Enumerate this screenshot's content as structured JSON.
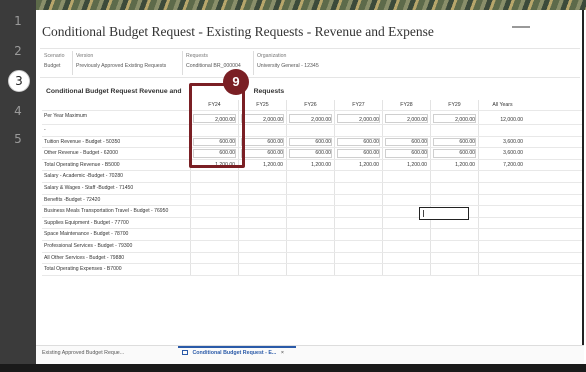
{
  "steps": [
    "1",
    "2",
    "3",
    "4",
    "5"
  ],
  "active_step": "3",
  "page_title": "Conditional Budget Request - Existing Requests - Revenue and Expense",
  "pov": [
    {
      "label": "Scenario",
      "value": "Budget"
    },
    {
      "label": "Version",
      "value": "Previously Approved Existing Requests"
    },
    {
      "label": "Requests",
      "value": "Conditional BR_000004"
    },
    {
      "label": "Organization",
      "value": "University General - 12345"
    }
  ],
  "grid_title": "Conditional Budget Request Revenue and Expense by Requests",
  "grid_title_visible": "Conditional Budget Request Revenue and",
  "grid_title_tail": "Requests",
  "columns": [
    "FY24",
    "FY25",
    "FY26",
    "FY27",
    "FY28",
    "FY29",
    "All Years"
  ],
  "rows": [
    {
      "label": "Per Year Maximum",
      "values": [
        "2,000.00",
        "2,000.00",
        "2,000.00",
        "2,000.00",
        "2,000.00",
        "2,000.00",
        "12,000.00"
      ]
    },
    {
      "label": "-",
      "values": [
        "",
        "",
        "",
        "",
        "",
        "",
        ""
      ]
    },
    {
      "label": "Tuition Revenue - Budget - 50350",
      "values": [
        "600.00",
        "600.00",
        "600.00",
        "600.00",
        "600.00",
        "600.00",
        "3,600.00"
      ]
    },
    {
      "label": "Other Revenue - Budget - 62000",
      "values": [
        "600.00",
        "600.00",
        "600.00",
        "600.00",
        "600.00",
        "600.00",
        "3,600.00"
      ]
    },
    {
      "label": "Total Operating Revenue - B5000",
      "values": [
        "1,200.00",
        "1,200.00",
        "1,200.00",
        "1,200.00",
        "1,200.00",
        "1,200.00",
        "7,200.00"
      ]
    },
    {
      "label": "Salary - Academic -Budget - 70280",
      "values": [
        "",
        "",
        "",
        "",
        "",
        "",
        ""
      ]
    },
    {
      "label": "Salary & Wages - Staff -Budget - 71450",
      "values": [
        "",
        "",
        "",
        "",
        "",
        "",
        ""
      ]
    },
    {
      "label": "Benefits -Budget - 72420",
      "values": [
        "",
        "",
        "",
        "",
        "",
        "",
        ""
      ]
    },
    {
      "label": "Business Meals Transportation Travel - Budget - 76950",
      "values": [
        "",
        "",
        "",
        "",
        "",
        "",
        ""
      ]
    },
    {
      "label": "Supplies Equipment - Budget - 77700",
      "values": [
        "",
        "",
        "",
        "",
        "",
        "",
        ""
      ]
    },
    {
      "label": "Space Maintenance - Budget - 78700",
      "values": [
        "",
        "",
        "",
        "",
        "",
        "",
        ""
      ]
    },
    {
      "label": "Professional Services - Budget - 79300",
      "values": [
        "",
        "",
        "",
        "",
        "",
        "",
        ""
      ]
    },
    {
      "label": "All Other Services - Budget - 79880",
      "values": [
        "",
        "",
        "",
        "",
        "",
        "",
        ""
      ]
    },
    {
      "label": "Total Operating Expenses - B7000",
      "values": [
        "",
        "",
        "",
        "",
        "",
        "",
        ""
      ]
    }
  ],
  "callout_number": "9",
  "tabs": [
    {
      "label": "Existing Approved Budget Reque...",
      "active": false
    },
    {
      "label": "Conditional Budget Request - E...",
      "active": true
    }
  ],
  "close_glyph": "×",
  "colors": {
    "callout": "#7a1f24",
    "active_tab": "#2a5aa8",
    "rail": "#3b3b3b"
  }
}
